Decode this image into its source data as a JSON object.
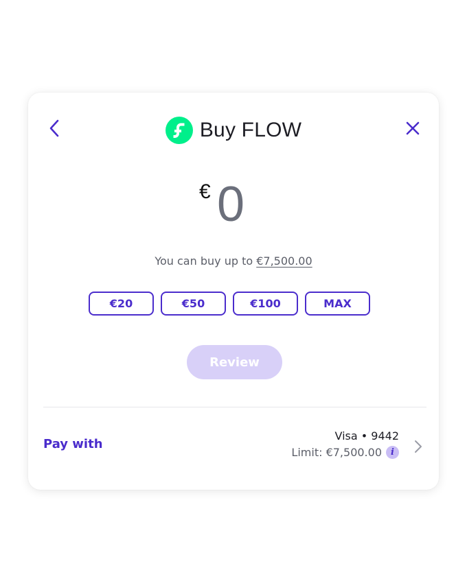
{
  "header": {
    "title": "Buy FLOW",
    "back_icon": "chevron-left-icon",
    "close_icon": "close-icon",
    "logo_icon": "flow-logo-icon"
  },
  "amount": {
    "currency_symbol": "€",
    "value": "0"
  },
  "limit_note": {
    "prefix": "You can buy up to ",
    "amount": "€7,500.00"
  },
  "presets": [
    "€20",
    "€50",
    "€100",
    "MAX"
  ],
  "review_label": "Review",
  "pay_with": {
    "label": "Pay with",
    "card": "Visa • 9442",
    "limit": "Limit: €7,500.00",
    "info_icon_glyph": "i"
  },
  "colors": {
    "accent": "#4a2ccc",
    "flow_green": "#00ef8b",
    "review_disabled": "#d8d0f8"
  }
}
